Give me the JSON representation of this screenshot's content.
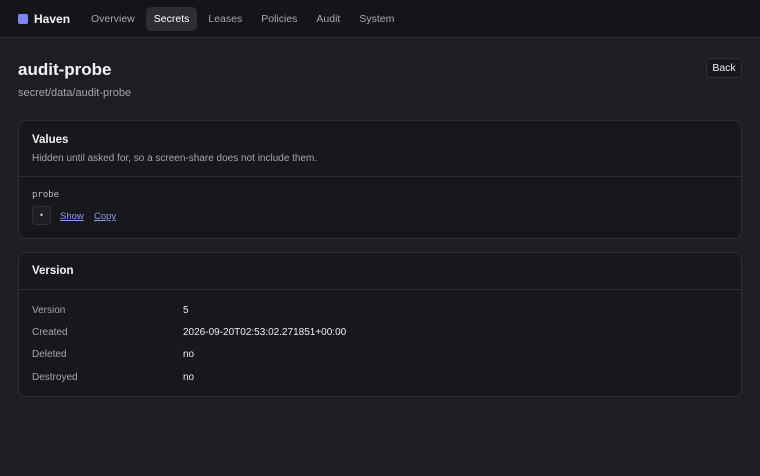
{
  "app": {
    "name": "Haven"
  },
  "nav": {
    "tabs": [
      "Overview",
      "Secrets",
      "Leases",
      "Policies",
      "Audit",
      "System"
    ],
    "active": "Secrets"
  },
  "page": {
    "title": "audit-probe",
    "path": "secret/data/audit-probe",
    "back_label": "Back"
  },
  "values_card": {
    "title": "Values",
    "description": "Hidden until asked for, so a screen-share does not include them.",
    "items": [
      {
        "key": "probe",
        "masked": "•",
        "show_label": "Show",
        "copy_label": "Copy"
      }
    ]
  },
  "version_card": {
    "title": "Version",
    "rows": [
      {
        "label": "Version",
        "value": "5"
      },
      {
        "label": "Created",
        "value": "2026-09-20T02:53:02.271851+00:00"
      },
      {
        "label": "Deleted",
        "value": "no"
      },
      {
        "label": "Destroyed",
        "value": "no"
      }
    ]
  },
  "colors": {
    "accent": "#7b85f5",
    "background": "#1d1e22",
    "card": "#17181b",
    "link": "#8f98f2"
  }
}
